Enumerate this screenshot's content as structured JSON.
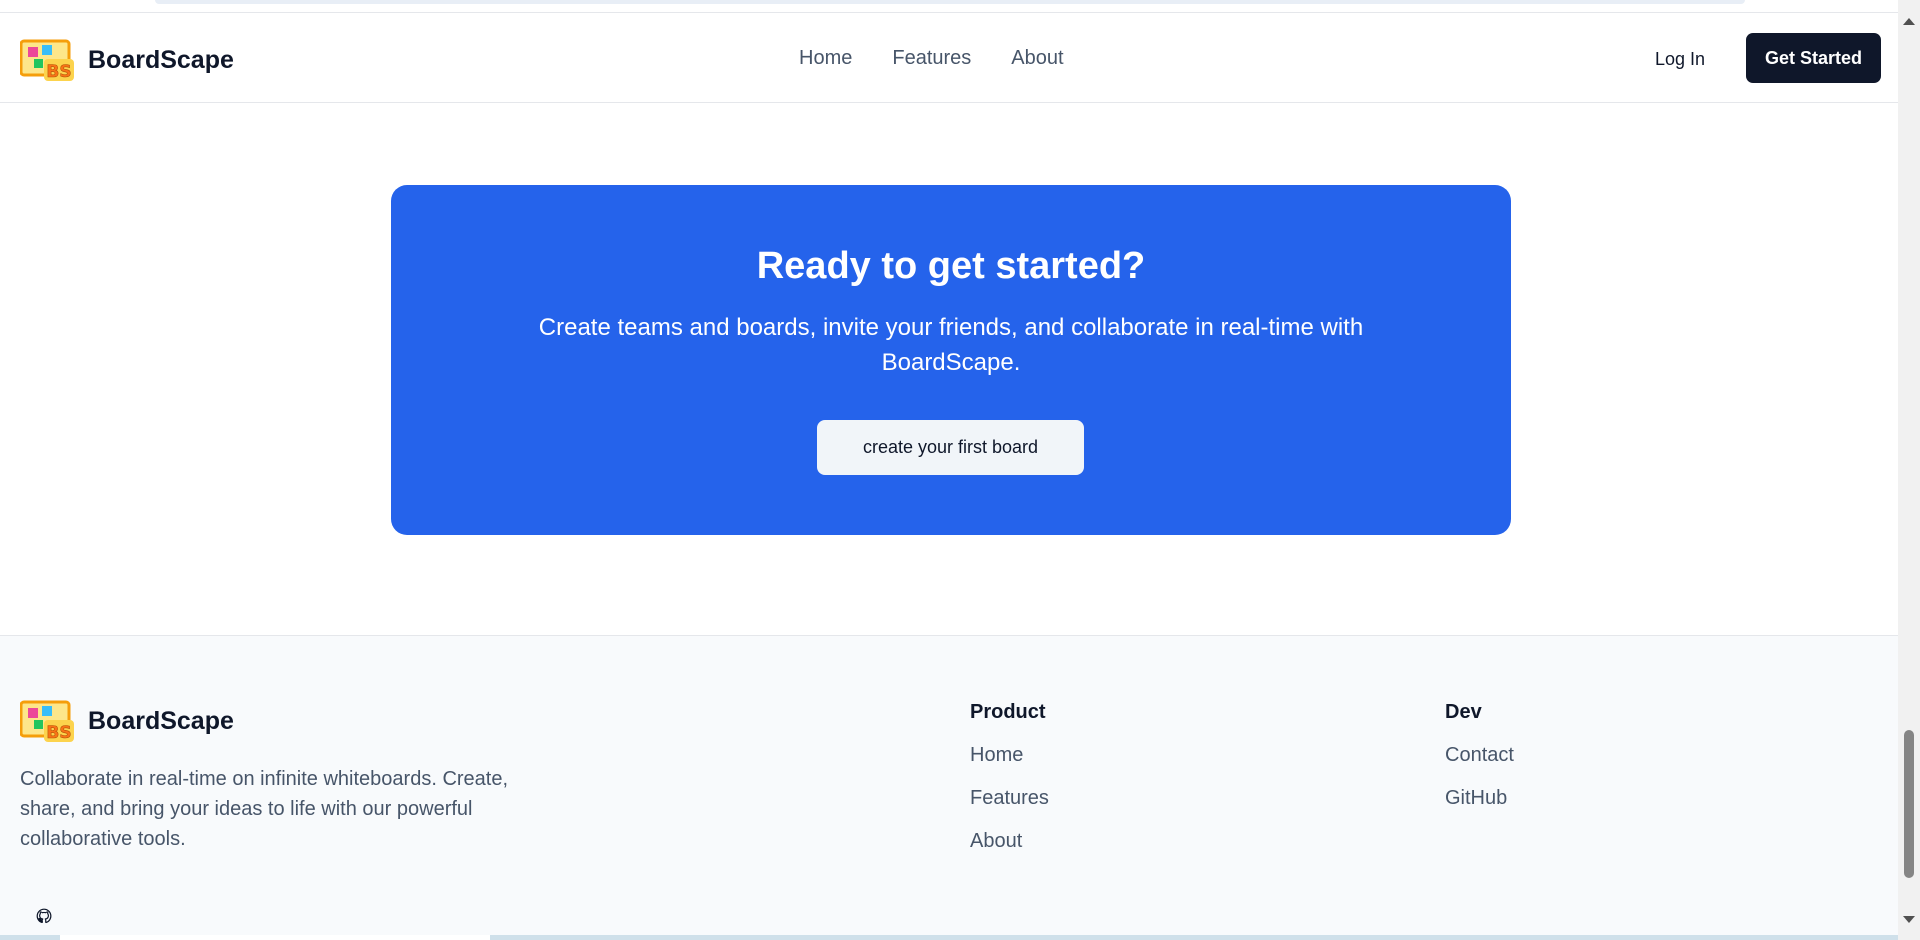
{
  "header": {
    "brand": "BoardScape",
    "logo_icon": "boardscape-logo-icon",
    "nav": [
      "Home",
      "Features",
      "About"
    ],
    "login_label": "Log In",
    "get_started_label": "Get Started"
  },
  "cta": {
    "title": "Ready to get started?",
    "description": "Create teams and boards, invite your friends, and collaborate in real-time with BoardScape.",
    "button_label": "create your first board"
  },
  "footer": {
    "brand": "BoardScape",
    "description": "Collaborate in real-time on infinite whiteboards. Create, share, and bring your ideas to life with our powerful collaborative tools.",
    "columns": [
      {
        "title": "Product",
        "links": [
          "Home",
          "Features",
          "About"
        ]
      },
      {
        "title": "Dev",
        "links": [
          "Contact",
          "GitHub"
        ]
      }
    ],
    "github_icon": "github-icon"
  },
  "colors": {
    "accent": "#2563eb",
    "dark": "#0f172a",
    "muted_text": "#475569",
    "footer_bg": "#f8fafc"
  }
}
